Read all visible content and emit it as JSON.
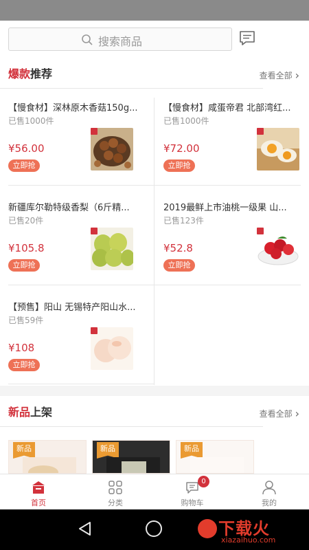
{
  "search": {
    "placeholder": "搜索商品"
  },
  "hot_section": {
    "title_accent": "爆款",
    "title_rest": "推荐",
    "view_all": "查看全部",
    "products": [
      {
        "name": "【慢食材】深林原木香菇150g...",
        "sold": "已售1000件",
        "price": "¥56.00",
        "buy_label": "立即抢",
        "image": "chestnut-mushroom-bowl"
      },
      {
        "name": "【慢食材】咸蛋帝君 北部湾红...",
        "sold": "已售1000件",
        "price": "¥72.00",
        "buy_label": "立即抢",
        "image": "salted-egg-yolks"
      },
      {
        "name": "新疆库尔勒特级香梨（6斤精...",
        "sold": "已售20件",
        "price": "¥105.8",
        "buy_label": "立即抢",
        "image": "green-pears"
      },
      {
        "name": "2019最鲜上市油桃一级果 山...",
        "sold": "已售123件",
        "price": "¥52.8",
        "buy_label": "立即抢",
        "image": "nectarines-bowl"
      },
      {
        "name": "【预售】阳山 无锡特产阳山水...",
        "sold": "已售59件",
        "price": "¥108",
        "buy_label": "立即抢",
        "image": "white-peaches"
      }
    ]
  },
  "new_section": {
    "title_accent": "新品",
    "title_rest": "上架",
    "view_all": "查看全部",
    "badge": "新品"
  },
  "bottom_nav": {
    "items": [
      {
        "label": "首页",
        "icon": "home-icon",
        "active": true
      },
      {
        "label": "分类",
        "icon": "category-grid-icon",
        "active": false
      },
      {
        "label": "购物车",
        "icon": "cart-icon",
        "active": false
      },
      {
        "label": "我的",
        "icon": "profile-icon",
        "active": false
      }
    ],
    "cart_count": "0"
  },
  "watermark": {
    "text": "下载火",
    "url": "xiazaihuo.com"
  },
  "colors": {
    "accent": "#d2323c",
    "buy_button": "#ee7156",
    "new_badge": "#ea9a32"
  }
}
